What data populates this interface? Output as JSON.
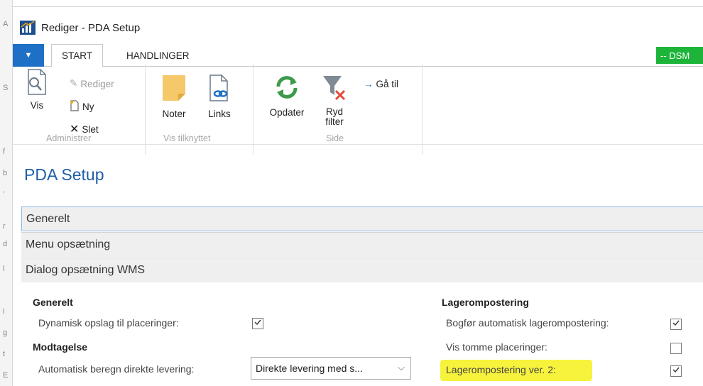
{
  "background": {
    "edge_letters": [
      "A",
      "S",
      "f",
      "b",
      "'",
      "r",
      "d",
      "l",
      "i",
      "g",
      "t",
      "E"
    ]
  },
  "window": {
    "title": "Rediger - PDA Setup",
    "app_icon": "chart-app-icon"
  },
  "tabs": {
    "menu_icon": "triangle-down-icon",
    "start": "START",
    "actions": "HANDLINGER",
    "badge": "-- DSM"
  },
  "ribbon": {
    "groups": {
      "administrer": "Administrer",
      "vis_tilknyttet": "Vis tilknyttet",
      "side": "Side"
    },
    "buttons": {
      "vis": "Vis",
      "rediger": "Rediger",
      "ny": "Ny",
      "slet": "Slet",
      "noter": "Noter",
      "links": "Links",
      "opdater": "Opdater",
      "ryd_filter_1": "Ryd",
      "ryd_filter_2": "filter",
      "gaa_til": "Gå til"
    }
  },
  "page": {
    "title": "PDA Setup",
    "sections": [
      "Generelt",
      "Menu opsætning",
      "Dialog opsætning WMS"
    ]
  },
  "form": {
    "left": {
      "group1": "Generelt",
      "dynamic_lookup_label": "Dynamisk opslag til placeringer:",
      "dynamic_lookup_checked": true,
      "group2": "Modtagelse",
      "auto_delivery_label": "Automatisk beregn direkte levering:",
      "auto_delivery_value": "Direkte levering med s..."
    },
    "right": {
      "group": "Lagerompostering",
      "auto_post_label": "Bogfør automatisk lagerompostering:",
      "auto_post_checked": true,
      "show_empty_label": "Vis tomme placeringer:",
      "show_empty_checked": false,
      "ver2_label": "Lagerompostering ver. 2:",
      "ver2_checked": true,
      "ver2_highlight_color": "#f7f23c"
    }
  },
  "colors": {
    "accent_blue": "#1e6fc6",
    "title_blue": "#1e5ea8",
    "badge_green": "#1db43a"
  }
}
